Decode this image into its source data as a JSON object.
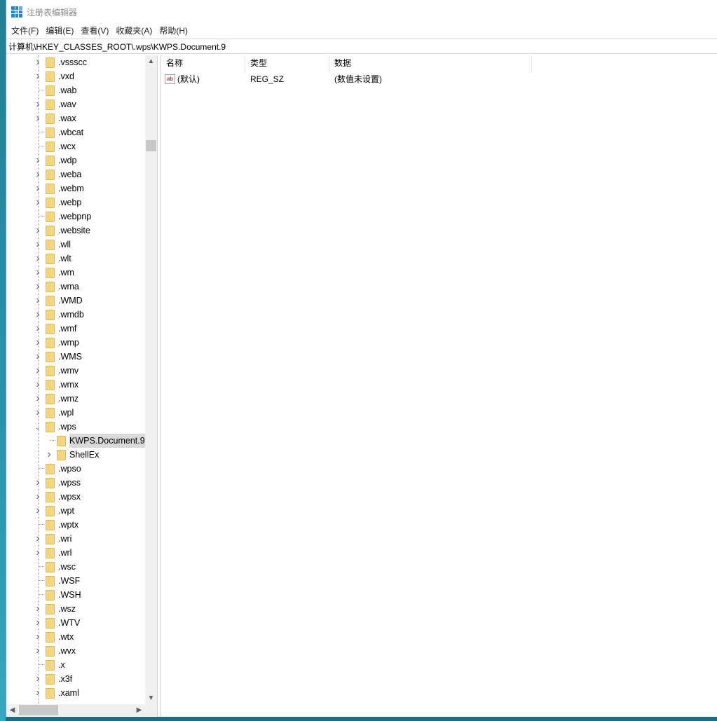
{
  "window": {
    "title": "注册表编辑器"
  },
  "menu": [
    "文件(F)",
    "编辑(E)",
    "查看(V)",
    "收藏夹(A)",
    "帮助(H)"
  ],
  "address": "计算机\\HKEY_CLASSES_ROOT\\.wps\\KWPS.Document.9",
  "tree": [
    {
      "label": ".vssscc",
      "level": 1,
      "expandable": true
    },
    {
      "label": ".vxd",
      "level": 1,
      "expandable": true
    },
    {
      "label": ".wab",
      "level": 1,
      "expandable": false
    },
    {
      "label": ".wav",
      "level": 1,
      "expandable": true
    },
    {
      "label": ".wax",
      "level": 1,
      "expandable": true
    },
    {
      "label": ".wbcat",
      "level": 1,
      "expandable": false
    },
    {
      "label": ".wcx",
      "level": 1,
      "expandable": false
    },
    {
      "label": ".wdp",
      "level": 1,
      "expandable": true
    },
    {
      "label": ".weba",
      "level": 1,
      "expandable": true
    },
    {
      "label": ".webm",
      "level": 1,
      "expandable": true
    },
    {
      "label": ".webp",
      "level": 1,
      "expandable": true
    },
    {
      "label": ".webpnp",
      "level": 1,
      "expandable": false
    },
    {
      "label": ".website",
      "level": 1,
      "expandable": true
    },
    {
      "label": ".wll",
      "level": 1,
      "expandable": true
    },
    {
      "label": ".wlt",
      "level": 1,
      "expandable": true
    },
    {
      "label": ".wm",
      "level": 1,
      "expandable": true
    },
    {
      "label": ".wma",
      "level": 1,
      "expandable": true
    },
    {
      "label": ".WMD",
      "level": 1,
      "expandable": true
    },
    {
      "label": ".wmdb",
      "level": 1,
      "expandable": true
    },
    {
      "label": ".wmf",
      "level": 1,
      "expandable": true
    },
    {
      "label": ".wmp",
      "level": 1,
      "expandable": true
    },
    {
      "label": ".WMS",
      "level": 1,
      "expandable": true
    },
    {
      "label": ".wmv",
      "level": 1,
      "expandable": true
    },
    {
      "label": ".wmx",
      "level": 1,
      "expandable": true
    },
    {
      "label": ".wmz",
      "level": 1,
      "expandable": true
    },
    {
      "label": ".wpl",
      "level": 1,
      "expandable": true
    },
    {
      "label": ".wps",
      "level": 1,
      "expandable": true,
      "expanded": true
    },
    {
      "label": "KWPS.Document.9",
      "level": 2,
      "expandable": false,
      "selected": true
    },
    {
      "label": "ShellEx",
      "level": 2,
      "expandable": true
    },
    {
      "label": ".wpso",
      "level": 1,
      "expandable": false
    },
    {
      "label": ".wpss",
      "level": 1,
      "expandable": true
    },
    {
      "label": ".wpsx",
      "level": 1,
      "expandable": true
    },
    {
      "label": ".wpt",
      "level": 1,
      "expandable": true
    },
    {
      "label": ".wptx",
      "level": 1,
      "expandable": false
    },
    {
      "label": ".wri",
      "level": 1,
      "expandable": true
    },
    {
      "label": ".wrl",
      "level": 1,
      "expandable": true
    },
    {
      "label": ".wsc",
      "level": 1,
      "expandable": false
    },
    {
      "label": ".WSF",
      "level": 1,
      "expandable": false
    },
    {
      "label": ".WSH",
      "level": 1,
      "expandable": false
    },
    {
      "label": ".wsz",
      "level": 1,
      "expandable": true
    },
    {
      "label": ".WTV",
      "level": 1,
      "expandable": true
    },
    {
      "label": ".wtx",
      "level": 1,
      "expandable": true
    },
    {
      "label": ".wvx",
      "level": 1,
      "expandable": true
    },
    {
      "label": ".x",
      "level": 1,
      "expandable": false
    },
    {
      "label": ".x3f",
      "level": 1,
      "expandable": true
    },
    {
      "label": ".xaml",
      "level": 1,
      "expandable": true
    }
  ],
  "columns": {
    "name": "名称",
    "type": "类型",
    "data": "数据"
  },
  "values": [
    {
      "name": "(默认)",
      "type": "REG_SZ",
      "data": "(数值未设置)",
      "icon": "ab"
    }
  ]
}
